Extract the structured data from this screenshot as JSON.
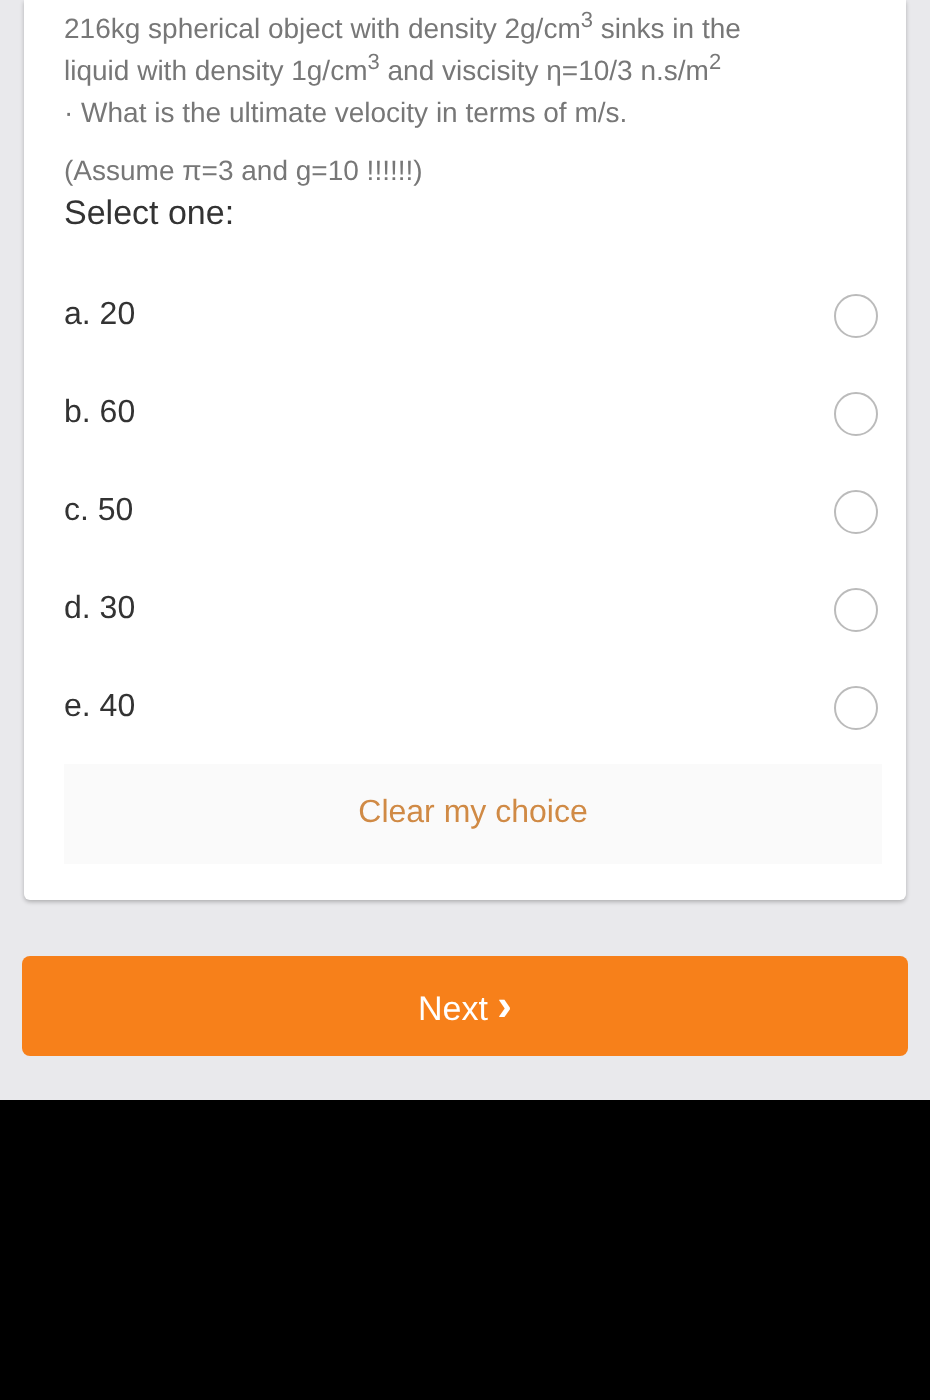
{
  "question": {
    "lines": [
      "216kg spherical object with density 2g/cm$^{3}$ sinks in the",
      "liquid with density 1g/cm$^{3}$  and viscisity η=10/3 n.s/m$^{2}$",
      "· What is the ultimate velocity in terms of  m/s."
    ],
    "note": "(Assume π=3 and g=10 !!!!!!)",
    "prompt": "Select one:"
  },
  "options": [
    {
      "label": "a. 20",
      "selected": false
    },
    {
      "label": "b. 60",
      "selected": false
    },
    {
      "label": "c. 50",
      "selected": false
    },
    {
      "label": "d. 30",
      "selected": false
    },
    {
      "label": "e. 40",
      "selected": false
    }
  ],
  "clear_button": {
    "label": "Clear my choice",
    "disabled": true
  },
  "next_button": {
    "label": "Next",
    "icon": "›"
  }
}
